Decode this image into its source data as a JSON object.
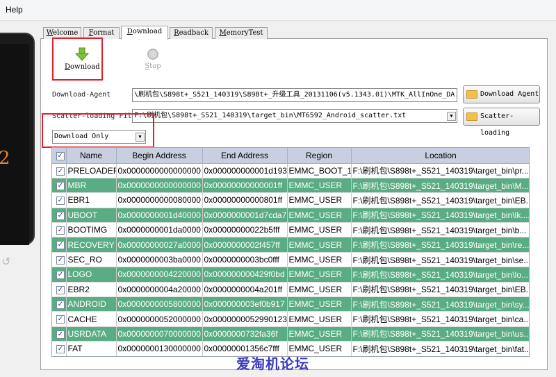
{
  "menu": {
    "help": "Help"
  },
  "phone": {
    "digit": "2",
    "back_icon": "back-arrow-icon"
  },
  "tabs": [
    {
      "label": "Welcome",
      "ul": "W",
      "rest": "elcome"
    },
    {
      "label": "Format",
      "ul": "F",
      "rest": "ormat"
    },
    {
      "label": "Download",
      "ul": "D",
      "rest": "ownload",
      "active": true
    },
    {
      "label": "Readback",
      "ul": "R",
      "rest": "eadback"
    },
    {
      "label": "MemoryTest",
      "ul": "M",
      "rest": "emoryTest"
    }
  ],
  "toolbar": {
    "download_ul": "D",
    "download_rest": "ownload",
    "stop_ul": "S",
    "stop_rest": "top"
  },
  "download_agent": {
    "label": "Download-Agent",
    "value": "\\刷机包\\S898t+_S521_140319\\S898t+_升级工具_20131106(v5.1343.01)\\MTK_AllInOne_DA.bin",
    "button": "Download Agent"
  },
  "scatter": {
    "label": "Scatter-loading File",
    "value": "F:\\刷机包\\S898t+_S521_140319\\target_bin\\MT6592_Android_scatter.txt",
    "button": "Scatter-loading"
  },
  "mode": {
    "selected": "Download Only"
  },
  "table": {
    "headers": [
      "Name",
      "Begin Address",
      "End Address",
      "Region",
      "Location"
    ],
    "rows": [
      {
        "name": "PRELOADER",
        "begin": "0x0000000000000000",
        "end": "0x000000000001d193",
        "region": "EMMC_BOOT_1",
        "location": "F:\\刷机包\\S898t+_S521_140319\\target_bin\\pr..."
      },
      {
        "name": "MBR",
        "begin": "0x0000000000000000",
        "end": "0x00000000000001ff",
        "region": "EMMC_USER",
        "location": "F:\\刷机包\\S898t+_S521_140319\\target_bin\\M..."
      },
      {
        "name": "EBR1",
        "begin": "0x0000000000080000",
        "end": "0x00000000000801ff",
        "region": "EMMC_USER",
        "location": "F:\\刷机包\\S898t+_S521_140319\\target_bin\\EB..."
      },
      {
        "name": "UBOOT",
        "begin": "0x0000000001d40000",
        "end": "0x0000000001d7cda7",
        "region": "EMMC_USER",
        "location": "F:\\刷机包\\S898t+_S521_140319\\target_bin\\lk...."
      },
      {
        "name": "BOOTIMG",
        "begin": "0x0000000001da0000",
        "end": "0x00000000022b5fff",
        "region": "EMMC_USER",
        "location": "F:\\刷机包\\S898t+_S521_140319\\target_bin\\b..."
      },
      {
        "name": "RECOVERY",
        "begin": "0x00000000027a0000",
        "end": "0x0000000002f457ff",
        "region": "EMMC_USER",
        "location": "F:\\刷机包\\S898t+_S521_140319\\target_bin\\re..."
      },
      {
        "name": "SEC_RO",
        "begin": "0x0000000003ba0000",
        "end": "0x0000000003bc0fff",
        "region": "EMMC_USER",
        "location": "F:\\刷机包\\S898t+_S521_140319\\target_bin\\se..."
      },
      {
        "name": "LOGO",
        "begin": "0x0000000004220000",
        "end": "0x000000000429f0bd",
        "region": "EMMC_USER",
        "location": "F:\\刷机包\\S898t+_S521_140319\\target_bin\\lo..."
      },
      {
        "name": "EBR2",
        "begin": "0x0000000004a20000",
        "end": "0x0000000004a201ff",
        "region": "EMMC_USER",
        "location": "F:\\刷机包\\S898t+_S521_140319\\target_bin\\EB..."
      },
      {
        "name": "ANDROID",
        "begin": "0x0000000005800000",
        "end": "0x000000003ef0b917",
        "region": "EMMC_USER",
        "location": "F:\\刷机包\\S898t+_S521_140319\\target_bin\\sy..."
      },
      {
        "name": "CACHE",
        "begin": "0x0000000052000000",
        "end": "0x0000000052990123",
        "region": "EMMC_USER",
        "location": "F:\\刷机包\\S898t+_S521_140319\\target_bin\\ca..."
      },
      {
        "name": "USRDATA",
        "begin": "0x0000000070000000",
        "end": "0x0000000732fa36f",
        "region": "EMMC_USER",
        "location": "F:\\刷机包\\S898t+_S521_140319\\target_bin\\us..."
      },
      {
        "name": "FAT",
        "begin": "0x0000000130000000",
        "end": "0x00000001356c7fff",
        "region": "EMMC_USER",
        "location": "F:\\刷机包\\S898t+_S521_140319\\target_bin\\fat..."
      }
    ]
  },
  "watermark": "爱淘机论坛",
  "colors": {
    "highlight_row": "#5aac84",
    "annotation_red": "#e0202a",
    "header_bg": "#c8cfe0"
  }
}
